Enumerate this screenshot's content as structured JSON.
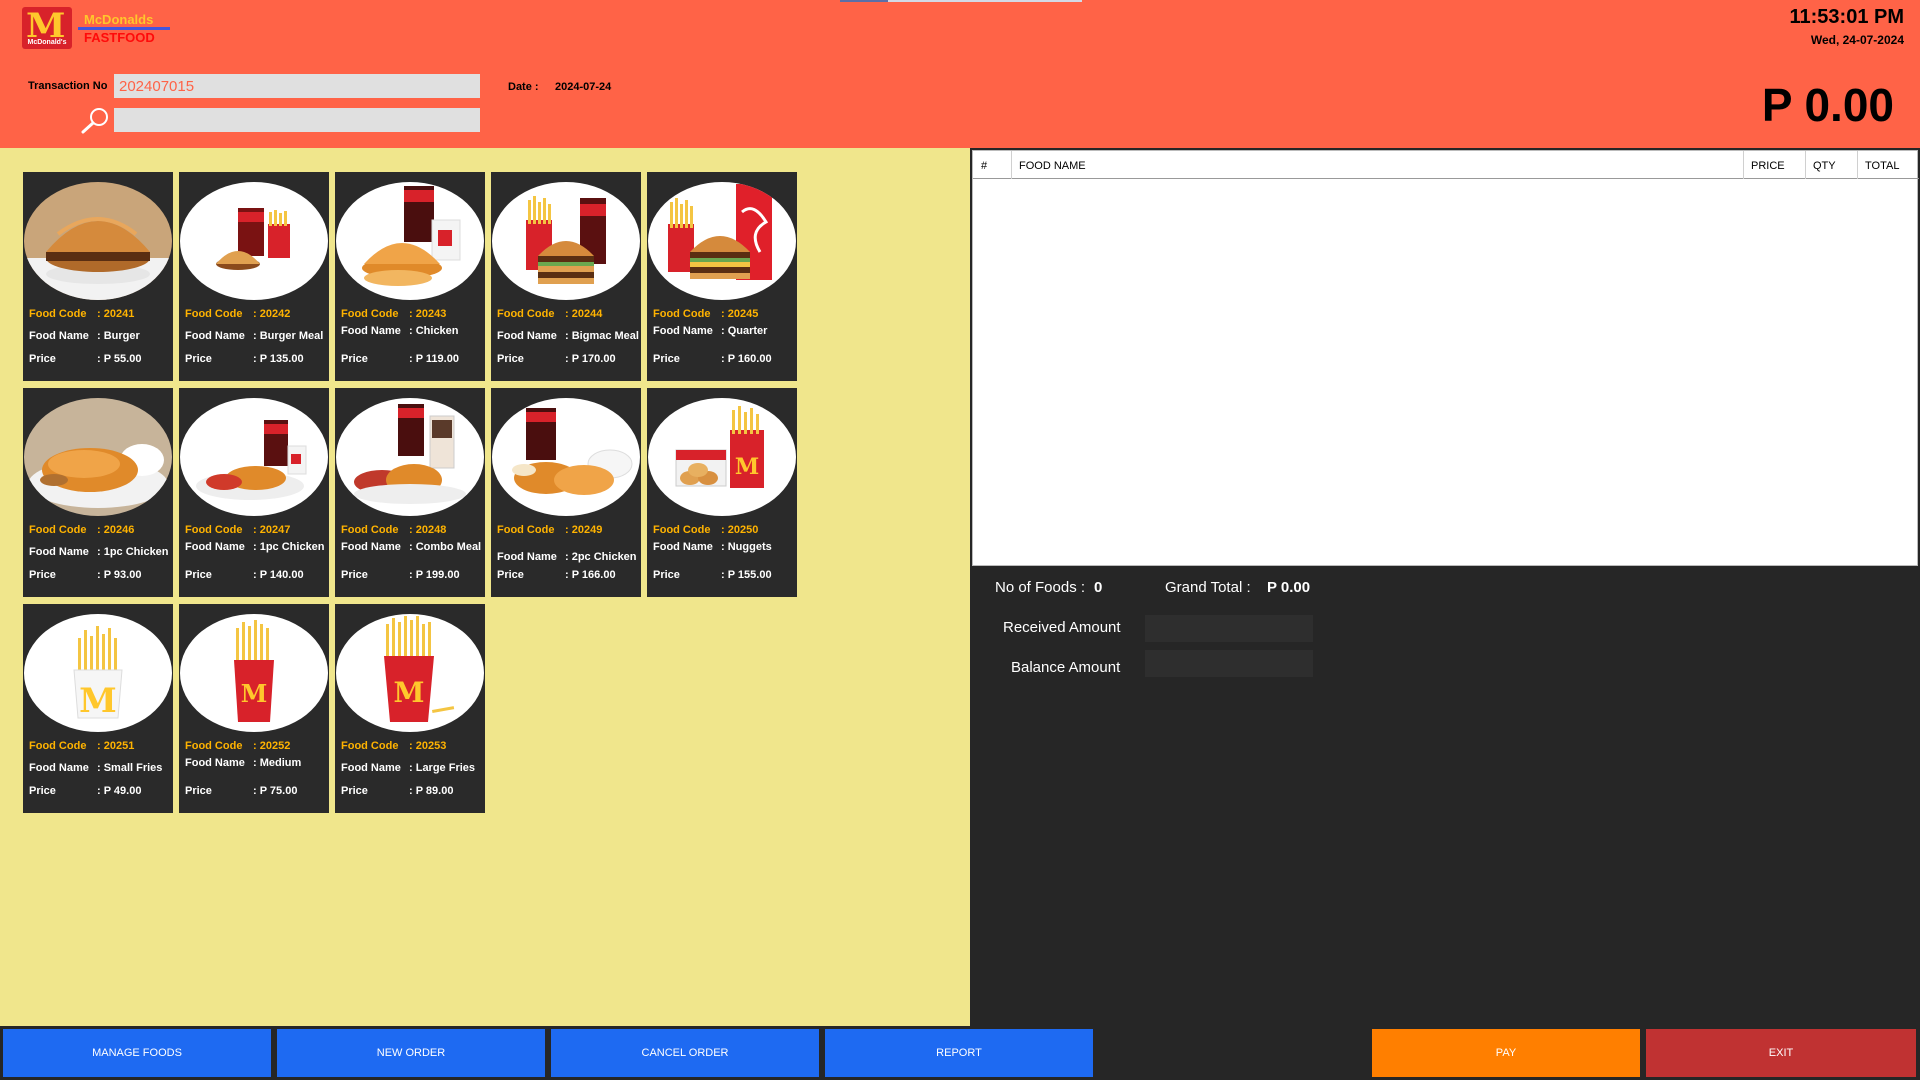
{
  "header": {
    "logo_text": "McDonald's",
    "brand_name": "McDonalds",
    "brand_sub": "FASTFOOD",
    "transaction_label": "Transaction No",
    "transaction_no": "202407015",
    "search_value": "",
    "date_label": "Date :",
    "date_value": "2024-07-24",
    "clock": "11:53:01 PM",
    "day": "Wed, 24-07-2024",
    "total": "P 0.00"
  },
  "food_labels": {
    "code": "Food Code",
    "name": "Food Name",
    "price": "Price"
  },
  "foods": [
    {
      "code": ": 20241",
      "name": ": Burger",
      "price": ": P 55.00"
    },
    {
      "code": ": 20242",
      "name": ": Burger Meal",
      "price": ": P 135.00"
    },
    {
      "code": ": 20243",
      "name": ": Chicken",
      "price": ": P 119.00"
    },
    {
      "code": ": 20244",
      "name": ": Bigmac Meal",
      "price": ": P 170.00"
    },
    {
      "code": ": 20245",
      "name": ": Quarter",
      "price": ": P 160.00"
    },
    {
      "code": ": 20246",
      "name": ": 1pc Chicken",
      "price": ": P 93.00"
    },
    {
      "code": ": 20247",
      "name": ": 1pc Chicken",
      "price": ": P 140.00"
    },
    {
      "code": ": 20248",
      "name": ": Combo Meal",
      "price": ": P 199.00"
    },
    {
      "code": ": 20249",
      "name": ": 2pc Chicken",
      "price": ": P 166.00"
    },
    {
      "code": ": 20250",
      "name": ": Nuggets",
      "price": ": P 155.00"
    },
    {
      "code": ": 20251",
      "name": ": Small Fries",
      "price": ": P 49.00"
    },
    {
      "code": ": 20252",
      "name": ": Medium",
      "price": ": P 75.00"
    },
    {
      "code": ": 20253",
      "name": ": Large Fries",
      "price": ": P 89.00"
    }
  ],
  "order_table": {
    "columns": [
      "#",
      "FOOD NAME",
      "PRICE",
      "QTY",
      "TOTAL"
    ],
    "rows": []
  },
  "summary": {
    "no_of_foods_label": "No of Foods :",
    "no_of_foods": "0",
    "grand_total_label": "Grand Total :",
    "grand_total": "P 0.00",
    "received_label": "Received Amount",
    "received_value": "",
    "balance_label": "Balance Amount",
    "balance_value": ""
  },
  "buttons": {
    "manage_foods": "MANAGE FOODS",
    "new_order": "NEW ORDER",
    "cancel_order": "CANCEL ORDER",
    "report": "REPORT",
    "pay": "PAY",
    "exit": "EXIT"
  },
  "colors": {
    "header_bg": "#ff6347",
    "food_panel_bg": "#f0e68c",
    "card_bg": "#2a2a2a",
    "code_text": "#ffb300",
    "dark_panel": "#262626",
    "button_blue": "#1e6af2",
    "button_pay": "#ff7f00",
    "button_exit": "#c03232"
  }
}
